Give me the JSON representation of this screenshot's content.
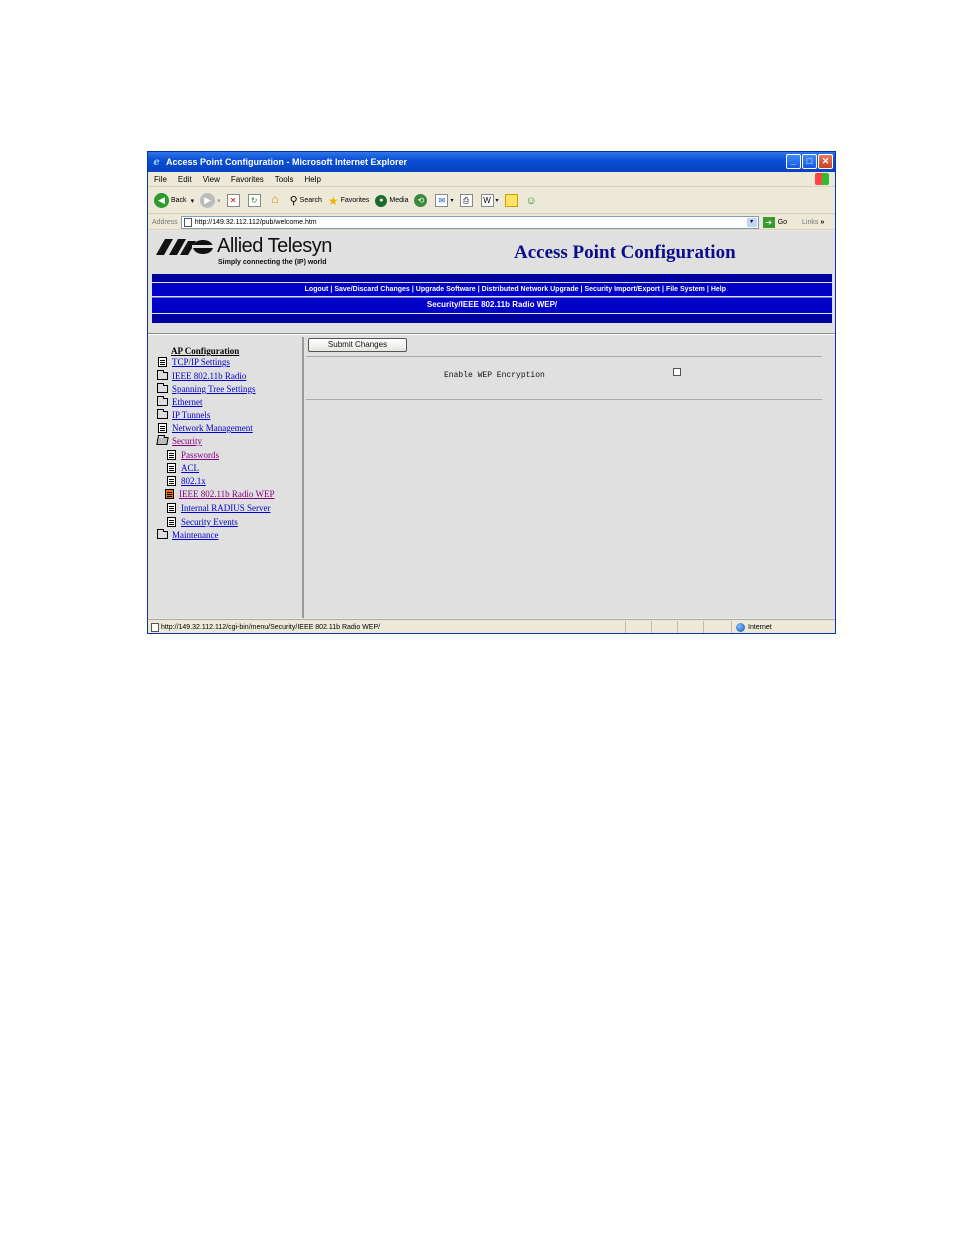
{
  "window": {
    "title": "Access Point Configuration - Microsoft Internet Explorer"
  },
  "menubar": [
    "File",
    "Edit",
    "View",
    "Favorites",
    "Tools",
    "Help"
  ],
  "toolbar": {
    "back": "Back",
    "search": "Search",
    "favorites": "Favorites",
    "media": "Media"
  },
  "address": {
    "label": "Address",
    "url": "http://149.32.112.112/pub/welcome.htm",
    "go": "Go",
    "links": "Links"
  },
  "page": {
    "brand_name": "Allied Telesyn",
    "tagline": "Simply connecting the (IP) world",
    "title": "Access Point Configuration",
    "nav": [
      "Logout",
      "Save/Discard Changes",
      "Upgrade Software",
      "Distributed Network Upgrade",
      "Security Import/Export",
      "File System",
      "Help"
    ],
    "breadcrumb": "Security/IEEE 802.11b Radio WEP/"
  },
  "sidebar": {
    "heading": "AP Configuration",
    "items": [
      {
        "label": "TCP/IP Settings",
        "icon": "document-icon"
      },
      {
        "label": "IEEE 802.11b Radio",
        "icon": "folder-icon"
      },
      {
        "label": "Spanning Tree Settings",
        "icon": "folder-icon"
      },
      {
        "label": "Ethernet",
        "icon": "folder-icon"
      },
      {
        "label": "IP Tunnels",
        "icon": "folder-icon"
      },
      {
        "label": "Network Management",
        "icon": "document-icon"
      },
      {
        "label": "Security",
        "icon": "open-folder-icon"
      },
      {
        "label": "Passwords",
        "icon": "document-icon"
      },
      {
        "label": "ACL",
        "icon": "document-icon"
      },
      {
        "label": "802.1x",
        "icon": "document-icon"
      },
      {
        "label": "IEEE 802.11b Radio WEP",
        "icon": "document-icon"
      },
      {
        "label": "Internal RADIUS Server",
        "icon": "document-icon"
      },
      {
        "label": "Security Events",
        "icon": "document-icon"
      },
      {
        "label": "Maintenance",
        "icon": "folder-icon"
      }
    ]
  },
  "main": {
    "submit_label": "Submit Changes",
    "wep_label": "Enable WEP Encryption",
    "wep_enabled": false
  },
  "status": {
    "url": "http://149.32.112.112/cgi-bin/menu/Security/IEEE 802.11b Radio WEP/",
    "zone": "Internet"
  },
  "colors": {
    "nav_blue": "#0000c8",
    "title_navy": "#0a0c8c",
    "link": "#0000cc",
    "visited": "#800080",
    "active_icon": "#e8711c"
  }
}
